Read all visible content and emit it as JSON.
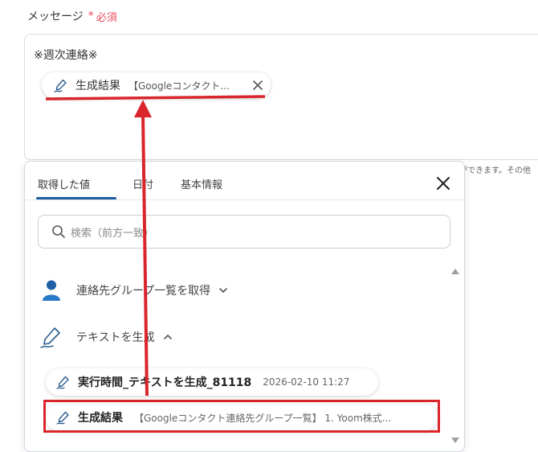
{
  "field": {
    "label": "メッセージ",
    "required_star": "*",
    "required_text": "必須"
  },
  "textarea": {
    "text": "※週次連絡※",
    "chip": {
      "title": "生成結果",
      "subtitle": "【Googleコンタクト..."
    }
  },
  "side_hint": "ができます。その他",
  "panel": {
    "tabs": [
      {
        "label": "取得した値",
        "active": true
      },
      {
        "label": "日付",
        "active": false
      },
      {
        "label": "基本情報",
        "active": false
      }
    ],
    "search_placeholder": "検索（前方一致）",
    "groups": [
      {
        "label": "連絡先グループ一覧を取得",
        "expanded": false,
        "icon": "person-icon"
      },
      {
        "label": "テキストを生成",
        "expanded": true,
        "icon": "pen-icon"
      }
    ],
    "items": [
      {
        "title": "実行時間_テキストを生成_81118",
        "subtitle": "2026-02-10 11:27"
      },
      {
        "title": "生成結果",
        "subtitle": "【Googleコンタクト連絡先グループ一覧】 1. Yoom株式..."
      }
    ]
  },
  "colors": {
    "accent": "#1a5fa0",
    "required": "#e84a5f",
    "annotation": "#d9262c"
  }
}
